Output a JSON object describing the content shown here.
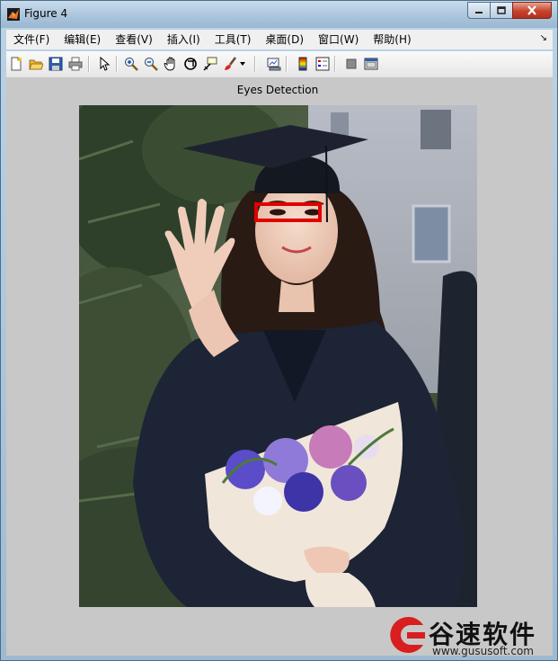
{
  "window": {
    "title": "Figure 4",
    "icon": "matlab-icon"
  },
  "menu": {
    "items": [
      "文件(F)",
      "编辑(E)",
      "查看(V)",
      "插入(I)",
      "工具(T)",
      "桌面(D)",
      "窗口(W)",
      "帮助(H)"
    ]
  },
  "toolbar": {
    "buttons": [
      "new-figure",
      "open-file",
      "save",
      "print",
      "edit-plot",
      "zoom-in",
      "zoom-out",
      "pan",
      "rotate-3d",
      "data-cursor",
      "brush",
      "brush-dropdown",
      "link-plot",
      "insert-colorbar",
      "insert-legend",
      "hide-plot-tools",
      "show-plot-tools"
    ]
  },
  "figure": {
    "axes_title": "Eyes Detection",
    "detection_box_color": "#e00000"
  },
  "watermark": {
    "brand": "谷速软件",
    "url": "www.gususoft.com",
    "color": "#d81e1e"
  }
}
